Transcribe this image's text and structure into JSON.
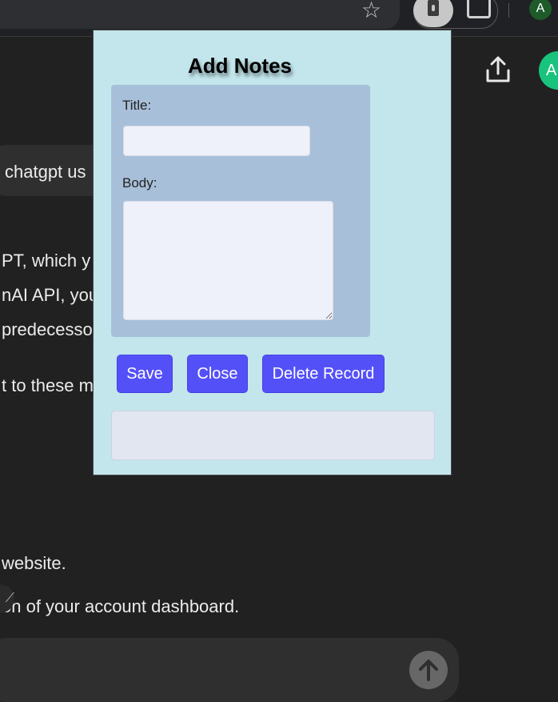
{
  "browser": {
    "star_icon": "star-icon",
    "extension_icon": "extension-icon",
    "puzzle_icon": "puzzle-icon",
    "profile_initial": "A"
  },
  "chat": {
    "avatar_initial": "A",
    "bubble_text": "chatgpt us",
    "lines": [
      "PT, which y",
      "nAI API, you",
      "predecesso",
      "t to these m",
      "website.",
      "on of your account dashboard."
    ],
    "accent": "#19c37d"
  },
  "popup": {
    "title": "Add Notes",
    "title_label": "Title:",
    "title_value": "",
    "body_label": "Body:",
    "body_value": "",
    "buttons": {
      "save": "Save",
      "close": "Close",
      "delete": "Delete Record"
    },
    "status_text": "",
    "colors": {
      "background": "#c2e6ec",
      "panel": "#a8bfd9",
      "button": "#5450f8"
    }
  }
}
